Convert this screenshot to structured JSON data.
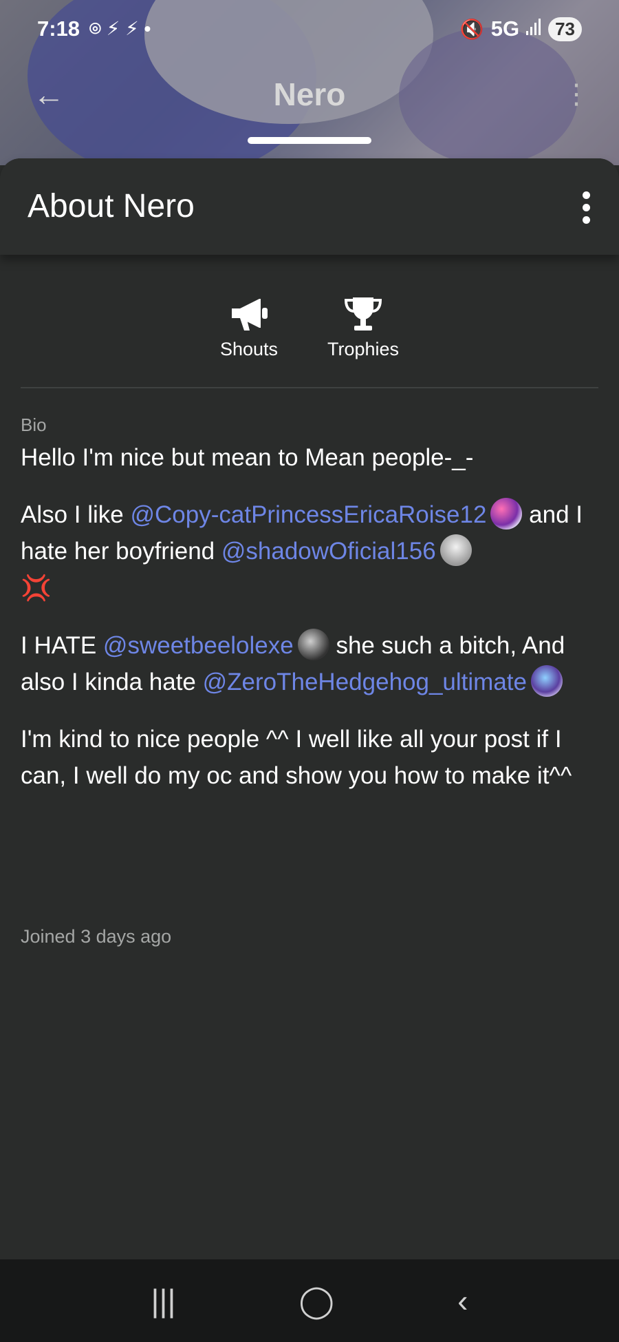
{
  "status_bar": {
    "time": "7:18",
    "left_icons": "⌾ ⚡ ⚡ •",
    "network": "5G",
    "signal": "📶",
    "mute_icon": "🔇",
    "battery": "73"
  },
  "app_bar": {
    "title": "Nero",
    "back_icon": "←",
    "more_icon": "⋮"
  },
  "sheet": {
    "title": "About Nero"
  },
  "tabs": [
    {
      "label": "Shouts",
      "icon": "megaphone-icon"
    },
    {
      "label": "Trophies",
      "icon": "trophy-icon"
    }
  ],
  "bio": {
    "label": "Bio",
    "p1": "Hello I'm nice but mean to Mean people-_-",
    "p2_a": "Also I like ",
    "p2_mention1": "@Copy-catPrincessEricaRoise12",
    "p2_b": " and I hate her boyfriend ",
    "p2_mention2": "@shadowOficial156",
    "p2_emoji": "💢",
    "p3_a": "I HATE ",
    "p3_mention1": "@sweetbeelolexe",
    "p3_b": " she such a bitch, And also I kinda hate ",
    "p3_mention2": "@ZeroTheHedgehog_ultimate",
    "p4": "I'm kind to nice people ^^ I well like all your post if I can, I well do my oc and show you how to make it^^"
  },
  "joined": "Joined 3 days ago",
  "navbar": {
    "recents": "|||",
    "home": "◯",
    "back": "‹"
  }
}
